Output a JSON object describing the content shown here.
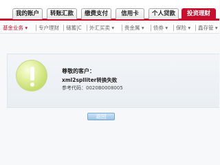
{
  "tabs": [
    {
      "label": "我的账户",
      "active": false
    },
    {
      "label": "转账汇款",
      "active": false
    },
    {
      "label": "缴费支付",
      "active": false
    },
    {
      "label": "信用卡",
      "active": false
    },
    {
      "label": "个人贷款",
      "active": false
    },
    {
      "label": "投资理财",
      "active": true
    }
  ],
  "subnav": [
    {
      "label": "基金业务 ▾",
      "active": true
    },
    {
      "label": "专户理财",
      "active": false
    },
    {
      "label": "储蓄|C",
      "active": false
    },
    {
      "label": "外汇买卖 ▾",
      "active": false
    },
    {
      "label": "贵金属 ▾",
      "active": false
    },
    {
      "label": "债券 ▾",
      "active": false
    },
    {
      "label": "保险 ▾",
      "active": false
    },
    {
      "label": "鑫存管 ▾",
      "active": false
    }
  ],
  "message": {
    "greeting": "尊敬的客户：",
    "error": "xml2splliter转换失败",
    "ref_label": "参考代码：",
    "ref_code": "0020B0008005"
  },
  "actions": {
    "back_label": "返回"
  },
  "icons": {
    "alert": "exclamation-icon"
  },
  "colors": {
    "accent": "#c8102e",
    "button": "#9cc3e8",
    "icon": "#c4dc6a"
  }
}
